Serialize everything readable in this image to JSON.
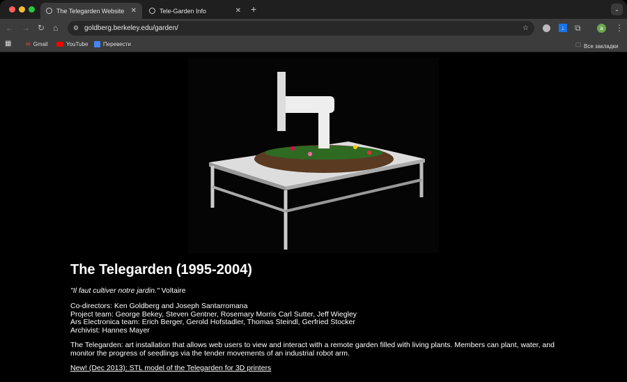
{
  "browser": {
    "tabs": [
      {
        "title": "The Telegarden Website",
        "active": true
      },
      {
        "title": "Tele-Garden Info",
        "active": false
      }
    ],
    "new_tab": "+",
    "url": "goldberg.berkeley.edu/garden/",
    "profile_initial": "a",
    "bookmarks": [
      "Gmail",
      "YouTube",
      "Перевести"
    ],
    "all_bookmarks": "Все закладки"
  },
  "page": {
    "title": "The Telegarden (1995-2004)",
    "quote": "\"Il faut cultiver notre jardin.\"",
    "quote_author": " Voltaire",
    "credits": [
      "Co-directors: Ken Goldberg and Joseph Santarromana",
      "Project team: George Bekey, Steven Gentner, Rosemary Morris Carl Sutter, Jeff Wiegley",
      "Ars Electronica team: Erich Berger, Gerold Hofstadler, Thomas Steindl, Gerfried Stocker",
      "Archivist: Hannes Mayer"
    ],
    "description": "The Telegarden: art installation that allows web users to view and interact with a remote garden filled with living plants. Members can plant, water, and monitor the progress of seedlings via the tender movements of an industrial robot arm.",
    "link": "New! (Dec 2013): STL model of the Telegarden for 3D printers"
  }
}
